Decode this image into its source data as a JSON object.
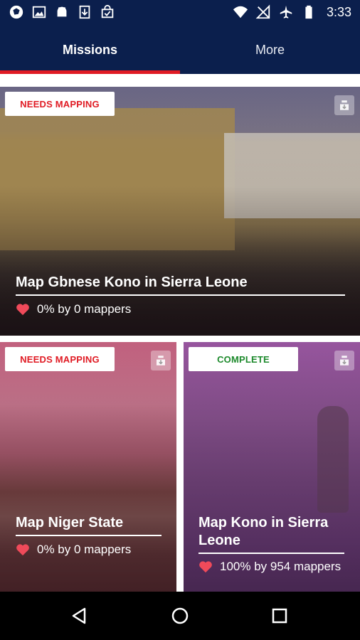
{
  "status_bar": {
    "time": "3:33",
    "left_icons": [
      "app-logo-icon",
      "image-icon",
      "android-icon",
      "download-icon",
      "check-bag-icon"
    ],
    "right_icons": [
      "wifi-icon",
      "no-signal-icon",
      "airplane-icon",
      "battery-icon"
    ]
  },
  "tabs": [
    {
      "label": "Missions",
      "active": true
    },
    {
      "label": "More",
      "active": false
    }
  ],
  "colors": {
    "header": "#0b1f4d",
    "tab_indicator": "#e01b24",
    "needs_mapping": "#e01b24",
    "complete": "#1d8a2c"
  },
  "missions": [
    {
      "status": "NEEDS MAPPING",
      "title": "Map Gbnese Kono in Sierra Leone",
      "stats": "0% by 0 mappers",
      "progress_percent": 0,
      "mappers": 0
    },
    {
      "status": "NEEDS MAPPING",
      "title": "Map Niger State",
      "stats": "0% by 0 mappers",
      "progress_percent": 0,
      "mappers": 0
    },
    {
      "status": "COMPLETE",
      "title": "Map Kono in Sierra Leone",
      "stats": "100% by 954 mappers",
      "progress_percent": 100,
      "mappers": 954
    }
  ],
  "nav_bar": {
    "buttons": [
      "back-icon",
      "home-icon",
      "recents-icon"
    ]
  }
}
